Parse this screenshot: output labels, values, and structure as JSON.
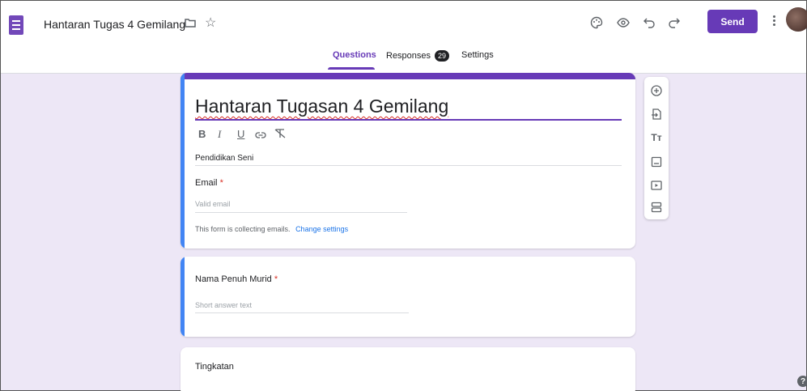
{
  "header": {
    "doc_title": "Hantaran Tugas 4 Gemilang",
    "send_label": "Send"
  },
  "tabs": [
    {
      "label": "Questions",
      "active": true
    },
    {
      "label": "Responses",
      "badge": "29"
    },
    {
      "label": "Settings"
    }
  ],
  "form": {
    "title": "Hantaran Tugasan 4 Gemilang",
    "format_buttons": [
      "B",
      "I",
      "U",
      "link",
      "clear-format"
    ],
    "description": "Pendidikan Seni",
    "email_label": "Email",
    "required_mark": "*",
    "email_placeholder": "Valid email",
    "collecting_notice": "This form is collecting emails.",
    "change_settings_link": "Change settings"
  },
  "questions": [
    {
      "label": "Nama Penuh Murid",
      "required": true,
      "placeholder": "Short answer text"
    },
    {
      "label": "Tingkatan"
    }
  ],
  "toolbar": {
    "items": [
      "add-question-icon",
      "import-questions-icon",
      "add-title-icon",
      "add-image-icon",
      "add-video-icon",
      "add-section-icon"
    ]
  },
  "help": {
    "label": "?"
  },
  "colors": {
    "accent": "#673ab7",
    "active_question": "#4285f4",
    "background": "#ede7f6"
  }
}
